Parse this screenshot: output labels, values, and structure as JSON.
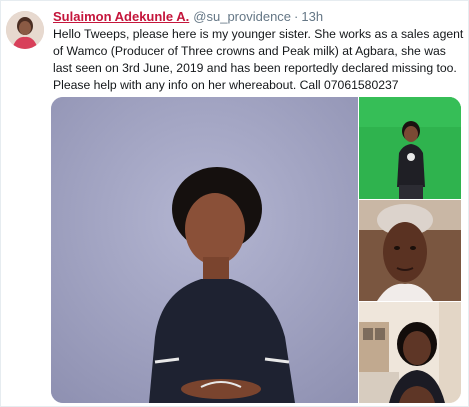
{
  "tweet": {
    "display_name": "Sulaimon Adekunle A.",
    "handle": "@su_providence",
    "separator": "·",
    "time": "13h",
    "text": "Hello Tweeps, please here is my younger sister. She works as a sales agent of Wamco (Producer of Three crowns and Peak milk) at Agbara, she was last seen on 3rd June, 2019 and has been reportedly declared missing too. Please help with any info on her whereabout. Call 07061580237"
  },
  "colors": {
    "display_name": "#c4153b",
    "secondary_text": "#657786",
    "border": "#e6ecf0",
    "photo_main_bg": "#a7a9c6",
    "photo_green_bg": "#2fb34e"
  },
  "media": {
    "photo_count": 4,
    "icons": [
      "avatar-photo",
      "woman-portrait-photo",
      "woman-green-screen-photo",
      "woman-selfie-photo",
      "woman-outdoor-photo"
    ]
  }
}
